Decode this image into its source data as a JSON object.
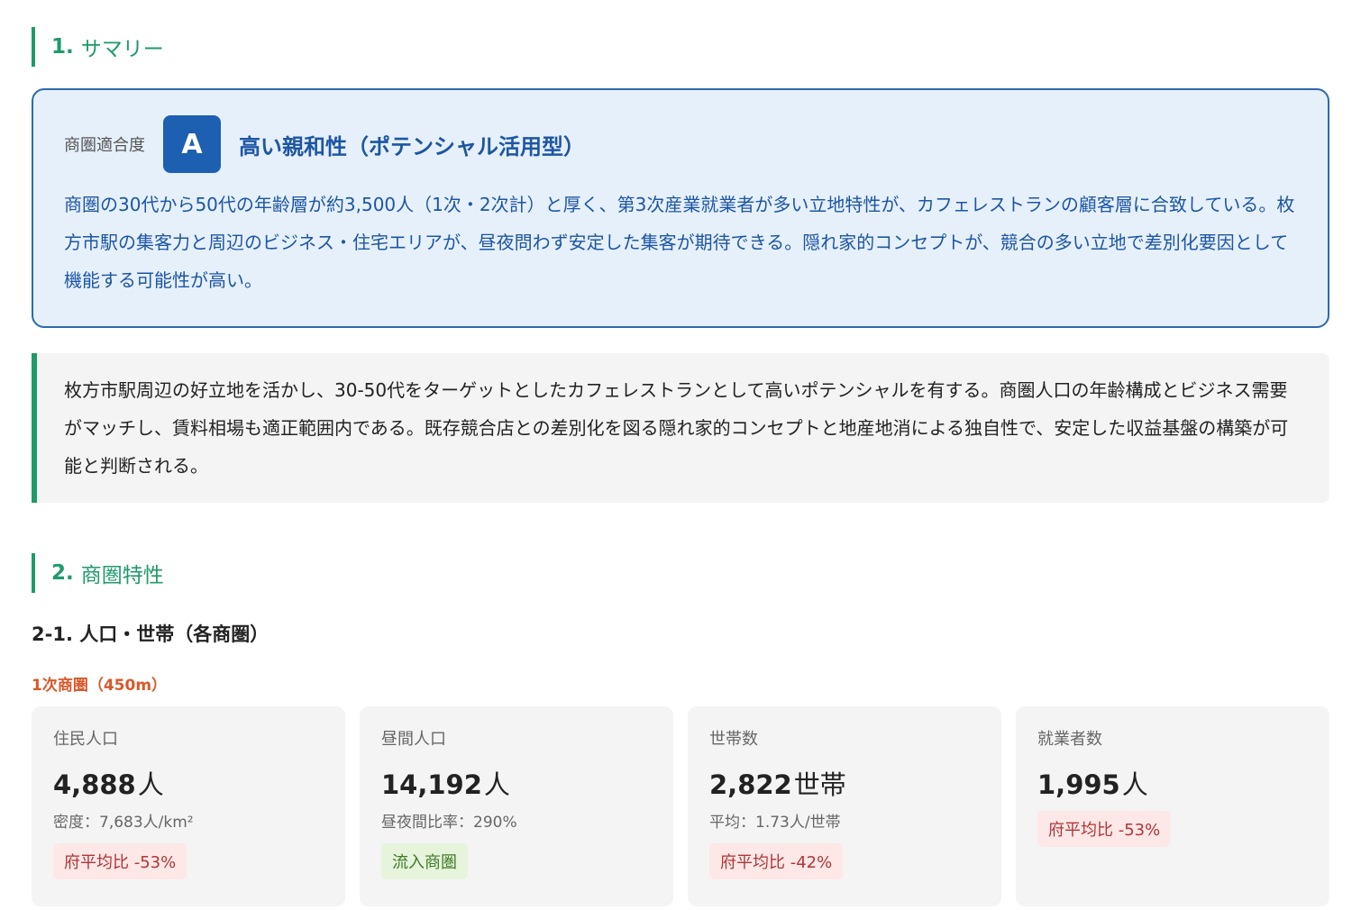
{
  "section1": {
    "num": "1.",
    "title": "サマリー"
  },
  "fit": {
    "label": "商圏適合度",
    "grade": "A",
    "title": "高い親和性（ポテンシャル活用型）",
    "description": "商圏の30代から50代の年齢層が約3,500人（1次・2次計）と厚く、第3次産業就業者が多い立地特性が、カフェレストランの顧客層に合致している。枚方市駅の集客力と周辺のビジネス・住宅エリアが、昼夜問わず安定した集客が期待できる。隠れ家的コンセプトが、競合の多い立地で差別化要因として機能する可能性が高い。"
  },
  "conclusion": "枚方市駅周辺の好立地を活かし、30-50代をターゲットとしたカフェレストランとして高いポテンシャルを有する。商圏人口の年齢構成とビジネス需要がマッチし、賃料相場も適正範囲内である。既存競合店との差別化を図る隠れ家的コンセプトと地産地消による独自性で、安定した収益基盤の構築が可能と判断される。",
  "section2": {
    "num": "2.",
    "title": "商圏特性"
  },
  "subsection": {
    "num": "2-1.",
    "title": "人口・世帯（各商圏）"
  },
  "area_label": "1次商圏（450m）",
  "cards": [
    {
      "label": "住民人口",
      "value": "4,888",
      "unit": "人",
      "sub": "密度：7,683人/km²",
      "badge": "府平均比 -53%",
      "badge_type": "neg"
    },
    {
      "label": "昼間人口",
      "value": "14,192",
      "unit": "人",
      "sub": "昼夜間比率：290%",
      "badge": "流入商圏",
      "badge_type": "pos"
    },
    {
      "label": "世帯数",
      "value": "2,822",
      "unit": "世帯",
      "sub": "平均：1.73人/世帯",
      "badge": "府平均比 -42%",
      "badge_type": "neg"
    },
    {
      "label": "就業者数",
      "value": "1,995",
      "unit": "人",
      "sub": "",
      "badge": "府平均比 -53%",
      "badge_type": "neg"
    }
  ],
  "colors": {
    "accent_green": "#1f9a6b",
    "accent_blue": "#1d5fb0",
    "area_orange": "#d9582a",
    "negative": "#b03636",
    "positive": "#3d7a23"
  }
}
